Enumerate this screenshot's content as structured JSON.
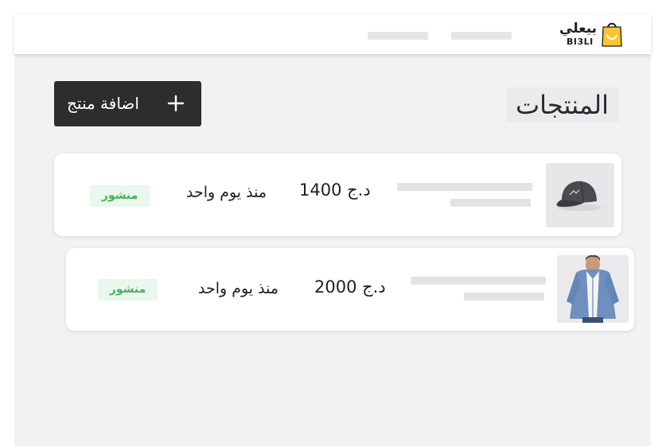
{
  "brand": {
    "name_ar": "بيعلي",
    "name_en": "BI3LI",
    "bag_color": "#f7c62f"
  },
  "header": {
    "nav_items": [
      "",
      ""
    ]
  },
  "page": {
    "title": "المنتجات",
    "add_button_label": "اضافة منتج",
    "add_button_icon": "plus-icon"
  },
  "products": [
    {
      "image": "cap",
      "name": "",
      "price": "1400 د.ج",
      "date": "منذ يوم واحد",
      "status": "منشور"
    },
    {
      "image": "hoodie",
      "name": "",
      "price": "2000 د.ج",
      "date": "منذ يوم واحد",
      "status": "منشور"
    }
  ],
  "colors": {
    "status_published_text": "#46b35d",
    "status_published_bg": "#e9f7ec",
    "button_bg": "#2d2d2d",
    "app_bg": "#f2f2f4"
  }
}
